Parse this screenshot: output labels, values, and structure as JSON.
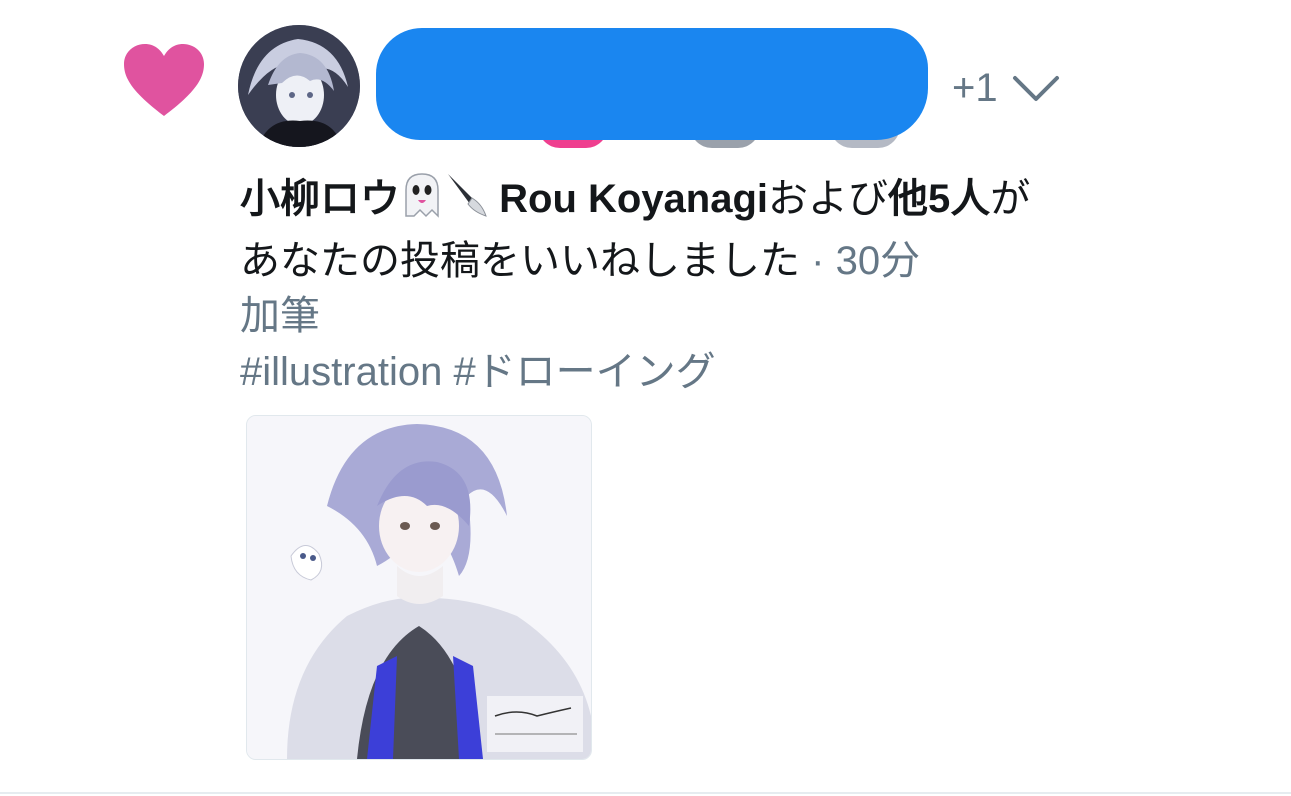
{
  "notification": {
    "type_icon": "heart-icon",
    "liker_name": "小柳ロウ",
    "liker_emojis": [
      "ghost-emoji",
      "knife-emoji"
    ],
    "liker_name_latin": "Rou Koyanagi",
    "connector": "および",
    "others": "他5人",
    "suffix_line1": "が",
    "action_text": "あなたの投稿をいいねしました",
    "separator": "·",
    "time": "30分",
    "more_count": "+1",
    "expand_icon": "chevron-down-icon"
  },
  "post": {
    "text": "加筆",
    "hashtags": "#illustration #ドローイング"
  },
  "colors": {
    "heart": "#e0539f",
    "muted": "#657786",
    "redaction": "#1a86f0",
    "text": "#14171a"
  }
}
